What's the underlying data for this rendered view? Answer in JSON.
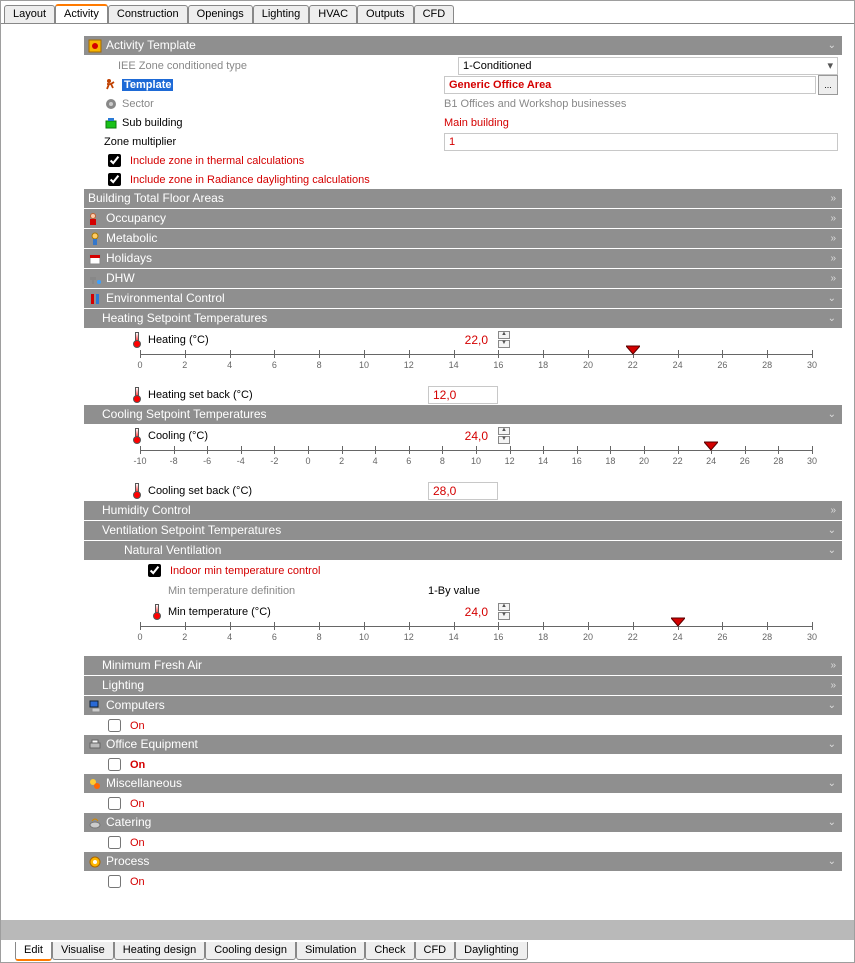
{
  "top_tabs": [
    "Layout",
    "Activity",
    "Construction",
    "Openings",
    "Lighting",
    "HVAC",
    "Outputs",
    "CFD"
  ],
  "top_active": 1,
  "bottom_tabs": [
    "Edit",
    "Visualise",
    "Heating design",
    "Cooling design",
    "Simulation",
    "Check",
    "CFD",
    "Daylighting"
  ],
  "bottom_active": 0,
  "activity": {
    "header": "Activity Template",
    "iee_label": "IEE Zone conditioned type",
    "iee_value": "1-Conditioned",
    "template_label": "Template",
    "template_value": "Generic Office Area",
    "ellipsis": "...",
    "sector_label": "Sector",
    "sector_value": "B1 Offices and Workshop businesses",
    "subbuild_label": "Sub building",
    "subbuild_value": "Main building",
    "zonemult_label": "Zone multiplier",
    "zonemult_value": "1",
    "ck_thermal": "Include zone in thermal calculations",
    "ck_radiance": "Include zone in Radiance daylighting calculations"
  },
  "headers": {
    "bfa": "Building Total Floor Areas",
    "occupancy": "Occupancy",
    "metabolic": "Metabolic",
    "holidays": "Holidays",
    "dhw": "DHW",
    "env": "Environmental Control",
    "heat_sp": "Heating Setpoint Temperatures",
    "cool_sp": "Cooling Setpoint Temperatures",
    "humidity": "Humidity Control",
    "vent_sp": "Ventilation Setpoint Temperatures",
    "natvent": "Natural Ventilation",
    "minfresh": "Minimum Fresh Air",
    "lighting": "Lighting",
    "computers": "Computers",
    "office_eq": "Office Equipment",
    "misc": "Miscellaneous",
    "catering": "Catering",
    "process": "Process"
  },
  "heating": {
    "label": "Heating (°C)",
    "value": "22,0",
    "setback_label": "Heating set back (°C)",
    "setback_value": "12,0",
    "ruler": {
      "min": 0,
      "max": 30,
      "step": 2,
      "marker": 22
    }
  },
  "cooling": {
    "label": "Cooling (°C)",
    "value": "24,0",
    "setback_label": "Cooling set back (°C)",
    "setback_value": "28,0",
    "ruler": {
      "min": -10,
      "max": 30,
      "step": 2,
      "marker": 24
    }
  },
  "natvent": {
    "ck": "Indoor min temperature control",
    "def_label": "Min temperature definition",
    "def_value": "1-By value",
    "min_label": "Min temperature (°C)",
    "min_value": "24,0",
    "ruler": {
      "min": 0,
      "max": 30,
      "step": 2,
      "marker": 24
    }
  },
  "on": "On"
}
